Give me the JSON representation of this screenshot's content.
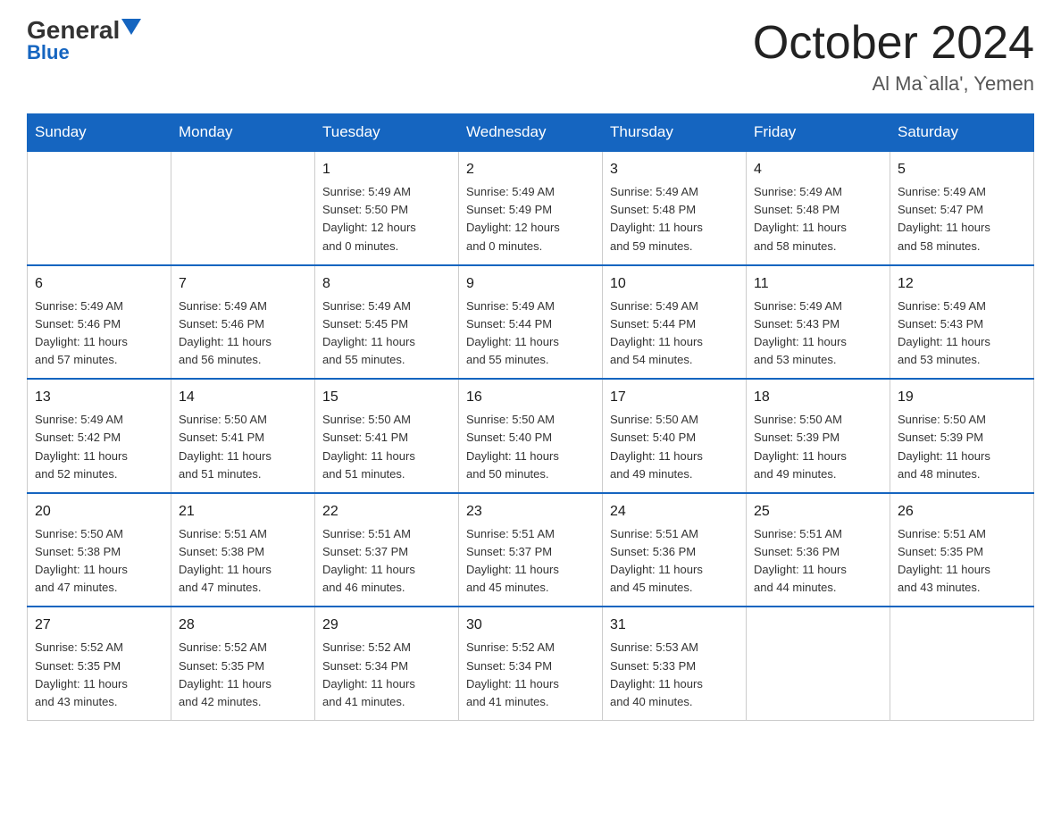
{
  "header": {
    "logo_general": "General",
    "logo_blue": "Blue",
    "title": "October 2024",
    "subtitle": "Al Ma`alla', Yemen"
  },
  "days_of_week": [
    "Sunday",
    "Monday",
    "Tuesday",
    "Wednesday",
    "Thursday",
    "Friday",
    "Saturday"
  ],
  "weeks": [
    [
      {
        "day": "",
        "info": ""
      },
      {
        "day": "",
        "info": ""
      },
      {
        "day": "1",
        "info": "Sunrise: 5:49 AM\nSunset: 5:50 PM\nDaylight: 12 hours\nand 0 minutes."
      },
      {
        "day": "2",
        "info": "Sunrise: 5:49 AM\nSunset: 5:49 PM\nDaylight: 12 hours\nand 0 minutes."
      },
      {
        "day": "3",
        "info": "Sunrise: 5:49 AM\nSunset: 5:48 PM\nDaylight: 11 hours\nand 59 minutes."
      },
      {
        "day": "4",
        "info": "Sunrise: 5:49 AM\nSunset: 5:48 PM\nDaylight: 11 hours\nand 58 minutes."
      },
      {
        "day": "5",
        "info": "Sunrise: 5:49 AM\nSunset: 5:47 PM\nDaylight: 11 hours\nand 58 minutes."
      }
    ],
    [
      {
        "day": "6",
        "info": "Sunrise: 5:49 AM\nSunset: 5:46 PM\nDaylight: 11 hours\nand 57 minutes."
      },
      {
        "day": "7",
        "info": "Sunrise: 5:49 AM\nSunset: 5:46 PM\nDaylight: 11 hours\nand 56 minutes."
      },
      {
        "day": "8",
        "info": "Sunrise: 5:49 AM\nSunset: 5:45 PM\nDaylight: 11 hours\nand 55 minutes."
      },
      {
        "day": "9",
        "info": "Sunrise: 5:49 AM\nSunset: 5:44 PM\nDaylight: 11 hours\nand 55 minutes."
      },
      {
        "day": "10",
        "info": "Sunrise: 5:49 AM\nSunset: 5:44 PM\nDaylight: 11 hours\nand 54 minutes."
      },
      {
        "day": "11",
        "info": "Sunrise: 5:49 AM\nSunset: 5:43 PM\nDaylight: 11 hours\nand 53 minutes."
      },
      {
        "day": "12",
        "info": "Sunrise: 5:49 AM\nSunset: 5:43 PM\nDaylight: 11 hours\nand 53 minutes."
      }
    ],
    [
      {
        "day": "13",
        "info": "Sunrise: 5:49 AM\nSunset: 5:42 PM\nDaylight: 11 hours\nand 52 minutes."
      },
      {
        "day": "14",
        "info": "Sunrise: 5:50 AM\nSunset: 5:41 PM\nDaylight: 11 hours\nand 51 minutes."
      },
      {
        "day": "15",
        "info": "Sunrise: 5:50 AM\nSunset: 5:41 PM\nDaylight: 11 hours\nand 51 minutes."
      },
      {
        "day": "16",
        "info": "Sunrise: 5:50 AM\nSunset: 5:40 PM\nDaylight: 11 hours\nand 50 minutes."
      },
      {
        "day": "17",
        "info": "Sunrise: 5:50 AM\nSunset: 5:40 PM\nDaylight: 11 hours\nand 49 minutes."
      },
      {
        "day": "18",
        "info": "Sunrise: 5:50 AM\nSunset: 5:39 PM\nDaylight: 11 hours\nand 49 minutes."
      },
      {
        "day": "19",
        "info": "Sunrise: 5:50 AM\nSunset: 5:39 PM\nDaylight: 11 hours\nand 48 minutes."
      }
    ],
    [
      {
        "day": "20",
        "info": "Sunrise: 5:50 AM\nSunset: 5:38 PM\nDaylight: 11 hours\nand 47 minutes."
      },
      {
        "day": "21",
        "info": "Sunrise: 5:51 AM\nSunset: 5:38 PM\nDaylight: 11 hours\nand 47 minutes."
      },
      {
        "day": "22",
        "info": "Sunrise: 5:51 AM\nSunset: 5:37 PM\nDaylight: 11 hours\nand 46 minutes."
      },
      {
        "day": "23",
        "info": "Sunrise: 5:51 AM\nSunset: 5:37 PM\nDaylight: 11 hours\nand 45 minutes."
      },
      {
        "day": "24",
        "info": "Sunrise: 5:51 AM\nSunset: 5:36 PM\nDaylight: 11 hours\nand 45 minutes."
      },
      {
        "day": "25",
        "info": "Sunrise: 5:51 AM\nSunset: 5:36 PM\nDaylight: 11 hours\nand 44 minutes."
      },
      {
        "day": "26",
        "info": "Sunrise: 5:51 AM\nSunset: 5:35 PM\nDaylight: 11 hours\nand 43 minutes."
      }
    ],
    [
      {
        "day": "27",
        "info": "Sunrise: 5:52 AM\nSunset: 5:35 PM\nDaylight: 11 hours\nand 43 minutes."
      },
      {
        "day": "28",
        "info": "Sunrise: 5:52 AM\nSunset: 5:35 PM\nDaylight: 11 hours\nand 42 minutes."
      },
      {
        "day": "29",
        "info": "Sunrise: 5:52 AM\nSunset: 5:34 PM\nDaylight: 11 hours\nand 41 minutes."
      },
      {
        "day": "30",
        "info": "Sunrise: 5:52 AM\nSunset: 5:34 PM\nDaylight: 11 hours\nand 41 minutes."
      },
      {
        "day": "31",
        "info": "Sunrise: 5:53 AM\nSunset: 5:33 PM\nDaylight: 11 hours\nand 40 minutes."
      },
      {
        "day": "",
        "info": ""
      },
      {
        "day": "",
        "info": ""
      }
    ]
  ]
}
